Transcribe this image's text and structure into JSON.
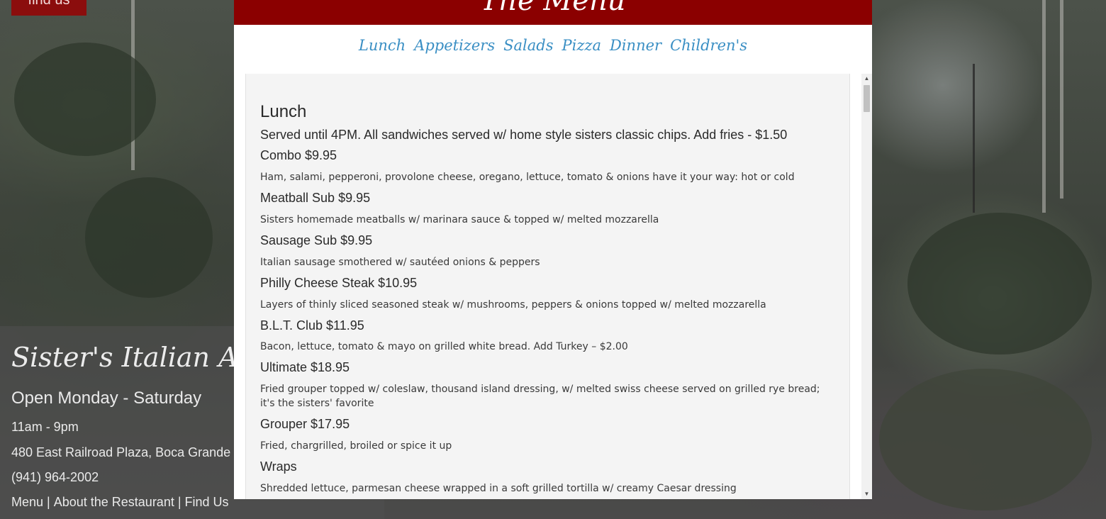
{
  "header": {
    "find_us_button": "find us"
  },
  "info": {
    "restaurant_name": "Sister's Italian American",
    "hours_title": "Open Monday - Saturday",
    "hours": "11am - 9pm",
    "address": "480 East Railroad Plaza, Boca Grande",
    "phone": "(941) 964-2002",
    "links": [
      "Menu",
      "About the Restaurant",
      "Find Us"
    ],
    "link_separator": "|"
  },
  "modal": {
    "title": "The Menu",
    "tabs": [
      "Lunch",
      "Appetizers",
      "Salads",
      "Pizza",
      "Dinner",
      "Children's"
    ],
    "section": {
      "title": "Lunch",
      "note": "Served until 4PM. All sandwiches served w/ home style sisters classic chips. Add fries - $1.50",
      "items": [
        {
          "name": "Combo $9.95",
          "desc": "Ham, salami, pepperoni, provolone cheese, oregano, lettuce, tomato & onions have it your way: hot or cold"
        },
        {
          "name": "Meatball Sub $9.95",
          "desc": "Sisters homemade meatballs w/ marinara sauce & topped w/ melted mozzarella"
        },
        {
          "name": "Sausage Sub $9.95",
          "desc": "Italian sausage smothered w/ sautéed onions & peppers"
        },
        {
          "name": "Philly Cheese Steak $10.95",
          "desc": "Layers of thinly sliced seasoned steak w/ mushrooms, peppers & onions topped w/ melted mozzarella"
        },
        {
          "name": "B.L.T. Club $11.95",
          "desc": "Bacon, lettuce, tomato & mayo on grilled white bread. Add Turkey – $2.00"
        },
        {
          "name": "Ultimate $18.95",
          "desc": "Fried grouper topped w/ coleslaw, thousand island dressing, w/ melted swiss cheese served on grilled rye bread; it's the sisters' favorite"
        },
        {
          "name": "Grouper $17.95",
          "desc": "Fried, chargrilled, broiled or spice it up"
        },
        {
          "name": "Wraps",
          "desc": "Shredded lettuce, parmesan cheese wrapped in a soft grilled tortilla w/ creamy Caesar dressing"
        }
      ]
    }
  },
  "colors": {
    "header_red": "#8b0000",
    "tab_blue": "#3a8fc4",
    "button_red": "#8b0d0d"
  },
  "icons": {
    "scroll_up": "arrow-up-icon",
    "scroll_down": "arrow-down-icon"
  }
}
